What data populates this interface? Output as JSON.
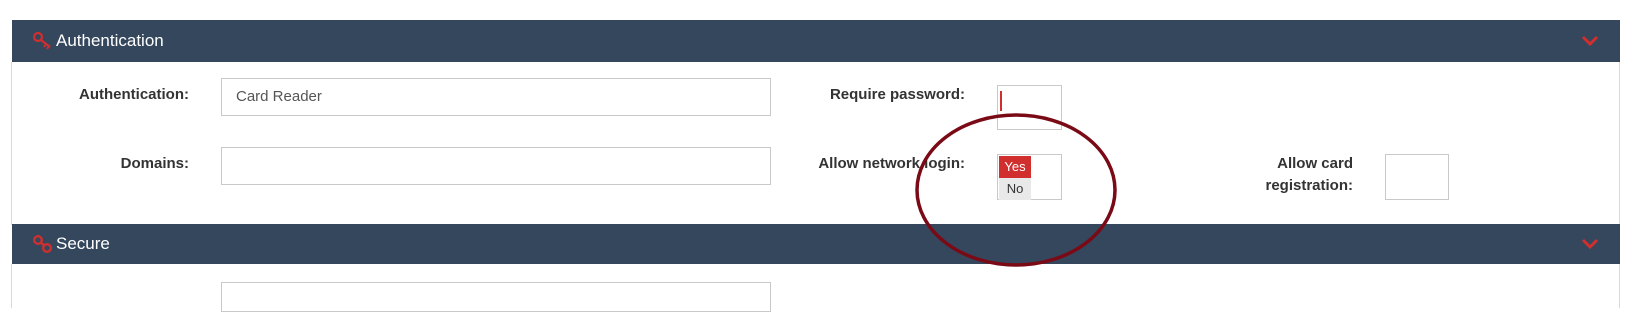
{
  "sections": {
    "authentication": {
      "title": "Authentication",
      "icon": "key-icon",
      "collapse_icon": "chevron-down-icon"
    },
    "secure": {
      "title": "Secure",
      "icon": "link-icon",
      "collapse_icon": "chevron-down-icon"
    }
  },
  "fields": {
    "authentication": {
      "label": "Authentication:",
      "value": "Card Reader"
    },
    "domains": {
      "label": "Domains:",
      "value": ""
    },
    "require_password": {
      "label": "Require password:"
    },
    "allow_network_login": {
      "label": "Allow network login:",
      "options": [
        "Yes",
        "No"
      ],
      "selected": "Yes"
    },
    "allow_card_registration": {
      "label_line1": "Allow card",
      "label_line2": "registration:"
    }
  },
  "colors": {
    "header_bg": "#34475d",
    "accent_red": "#d12e2e",
    "annotation_circle": "#7a0a16"
  }
}
